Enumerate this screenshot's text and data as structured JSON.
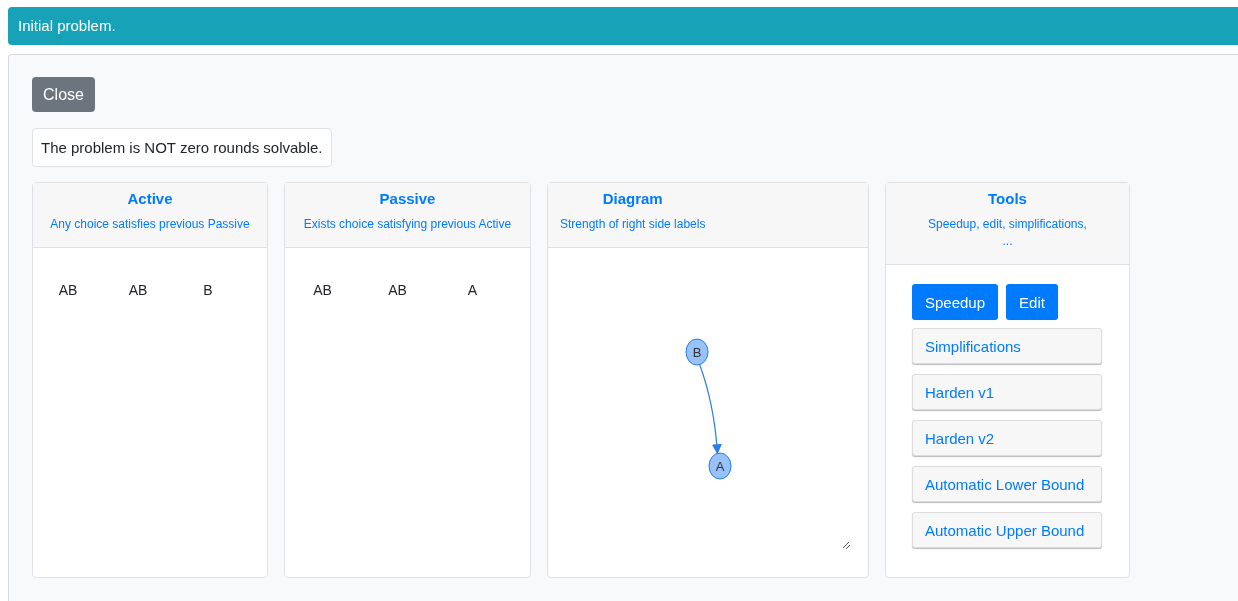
{
  "banner": {
    "text": "Initial problem."
  },
  "close_button": {
    "label": "Close"
  },
  "status": {
    "text": "The problem is NOT zero rounds solvable."
  },
  "cards": [
    {
      "kind": "labels",
      "title": "Active",
      "subtitle": "Any choice satisfies previous Passive",
      "labels": [
        "AB",
        "AB",
        "B"
      ]
    },
    {
      "kind": "labels",
      "title": "Passive",
      "subtitle": "Exists choice satisfying previous Active",
      "labels": [
        "AB",
        "AB",
        "A"
      ]
    },
    {
      "kind": "diagram",
      "title": "Diagram",
      "subtitle": "Strength of right side labels",
      "nodes": [
        {
          "label": "B"
        },
        {
          "label": "A"
        }
      ]
    },
    {
      "kind": "tools",
      "title": "Tools",
      "subtitle": "Speedup, edit, simplifications, ...",
      "buttons": [
        {
          "kind": "primary",
          "label": "Speedup"
        },
        {
          "kind": "primary",
          "label": "Edit"
        },
        {
          "kind": "light",
          "label": "Simplifications"
        },
        {
          "kind": "light",
          "label": "Harden v1"
        },
        {
          "kind": "light",
          "label": "Harden v2"
        },
        {
          "kind": "light",
          "label": "Automatic Lower Bound"
        },
        {
          "kind": "light",
          "label": "Automatic Upper Bound"
        }
      ]
    }
  ]
}
